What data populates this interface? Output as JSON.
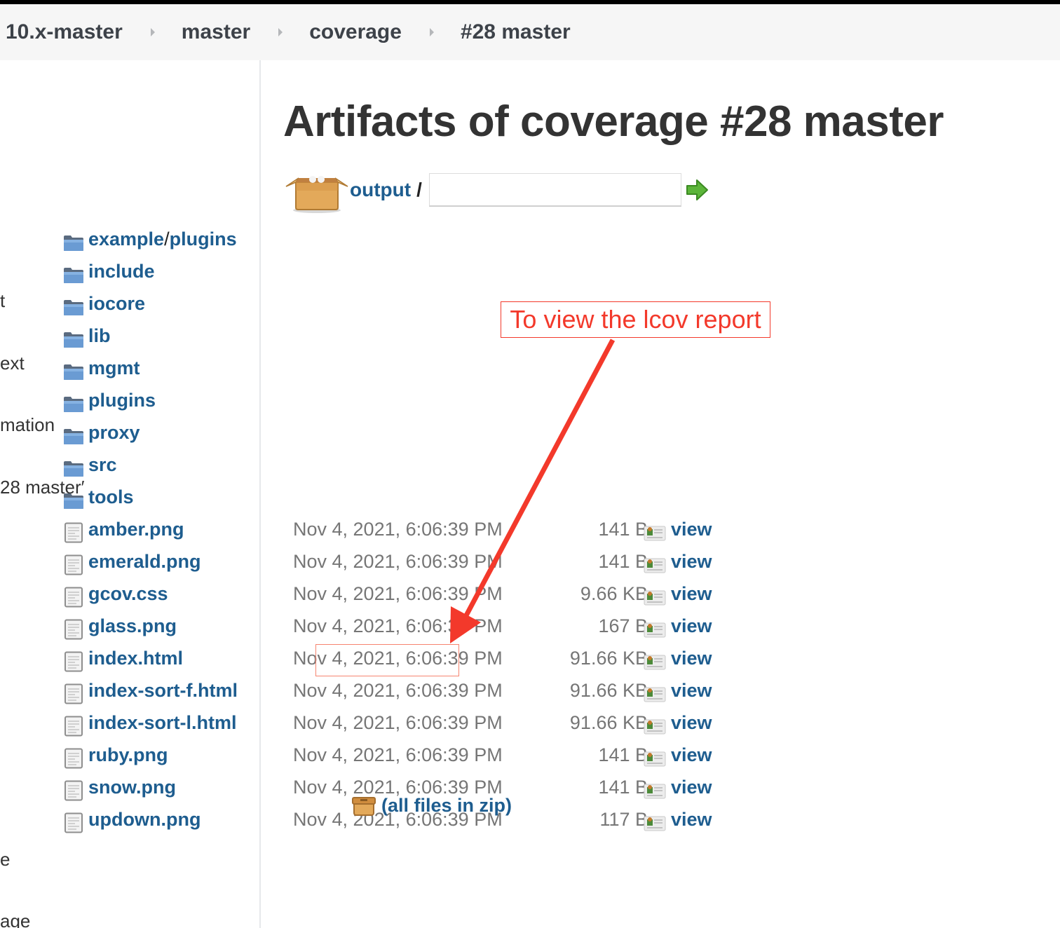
{
  "breadcrumbs": [
    {
      "label": "10.x-master"
    },
    {
      "label": "master"
    },
    {
      "label": "coverage"
    },
    {
      "label": "#28 master"
    }
  ],
  "sidebar": {
    "items": [
      {
        "label": "t"
      },
      {
        "label": "ext"
      },
      {
        "label": "mation"
      },
      {
        "label": "28 master′"
      },
      {
        "label": "e"
      },
      {
        "label": "age"
      }
    ]
  },
  "main": {
    "title": "Artifacts of coverage #28 master",
    "path": {
      "root_label": "output",
      "separator": "/",
      "input_value": "",
      "input_placeholder": ""
    },
    "directories": [
      {
        "parts": [
          "example",
          "plugins"
        ]
      },
      {
        "parts": [
          "include"
        ]
      },
      {
        "parts": [
          "iocore"
        ]
      },
      {
        "parts": [
          "lib"
        ]
      },
      {
        "parts": [
          "mgmt"
        ]
      },
      {
        "parts": [
          "plugins"
        ]
      },
      {
        "parts": [
          "proxy"
        ]
      },
      {
        "parts": [
          "src"
        ]
      },
      {
        "parts": [
          "tools"
        ]
      }
    ],
    "files": [
      {
        "name": "amber.png",
        "date": "Nov 4, 2021, 6:06:39 PM",
        "size": "141 B",
        "view": "view"
      },
      {
        "name": "emerald.png",
        "date": "Nov 4, 2021, 6:06:39 PM",
        "size": "141 B",
        "view": "view"
      },
      {
        "name": "gcov.css",
        "date": "Nov 4, 2021, 6:06:39 PM",
        "size": "9.66 KB",
        "view": "view"
      },
      {
        "name": "glass.png",
        "date": "Nov 4, 2021, 6:06:39 PM",
        "size": "167 B",
        "view": "view"
      },
      {
        "name": "index.html",
        "date": "Nov 4, 2021, 6:06:39 PM",
        "size": "91.66 KB",
        "view": "view",
        "highlighted": true
      },
      {
        "name": "index-sort-f.html",
        "date": "Nov 4, 2021, 6:06:39 PM",
        "size": "91.66 KB",
        "view": "view"
      },
      {
        "name": "index-sort-l.html",
        "date": "Nov 4, 2021, 6:06:39 PM",
        "size": "91.66 KB",
        "view": "view"
      },
      {
        "name": "ruby.png",
        "date": "Nov 4, 2021, 6:06:39 PM",
        "size": "141 B",
        "view": "view"
      },
      {
        "name": "snow.png",
        "date": "Nov 4, 2021, 6:06:39 PM",
        "size": "141 B",
        "view": "view"
      },
      {
        "name": "updown.png",
        "date": "Nov 4, 2021, 6:06:39 PM",
        "size": "117 B",
        "view": "view"
      }
    ],
    "zip_label": "(all files in zip)"
  },
  "annotation": {
    "text": "To view the lcov report",
    "target_file": "index.html",
    "color": "#f3392b"
  },
  "colors": {
    "link": "#1e5d8f",
    "muted": "#767676",
    "heading": "#333333",
    "breadcrumb_bg": "#f6f6f6"
  },
  "icons": {
    "directory": "folder-icon",
    "file": "file-icon",
    "view": "view-icon",
    "root": "package-box-icon",
    "go": "go-arrow-icon",
    "zip": "zip-archive-icon"
  }
}
